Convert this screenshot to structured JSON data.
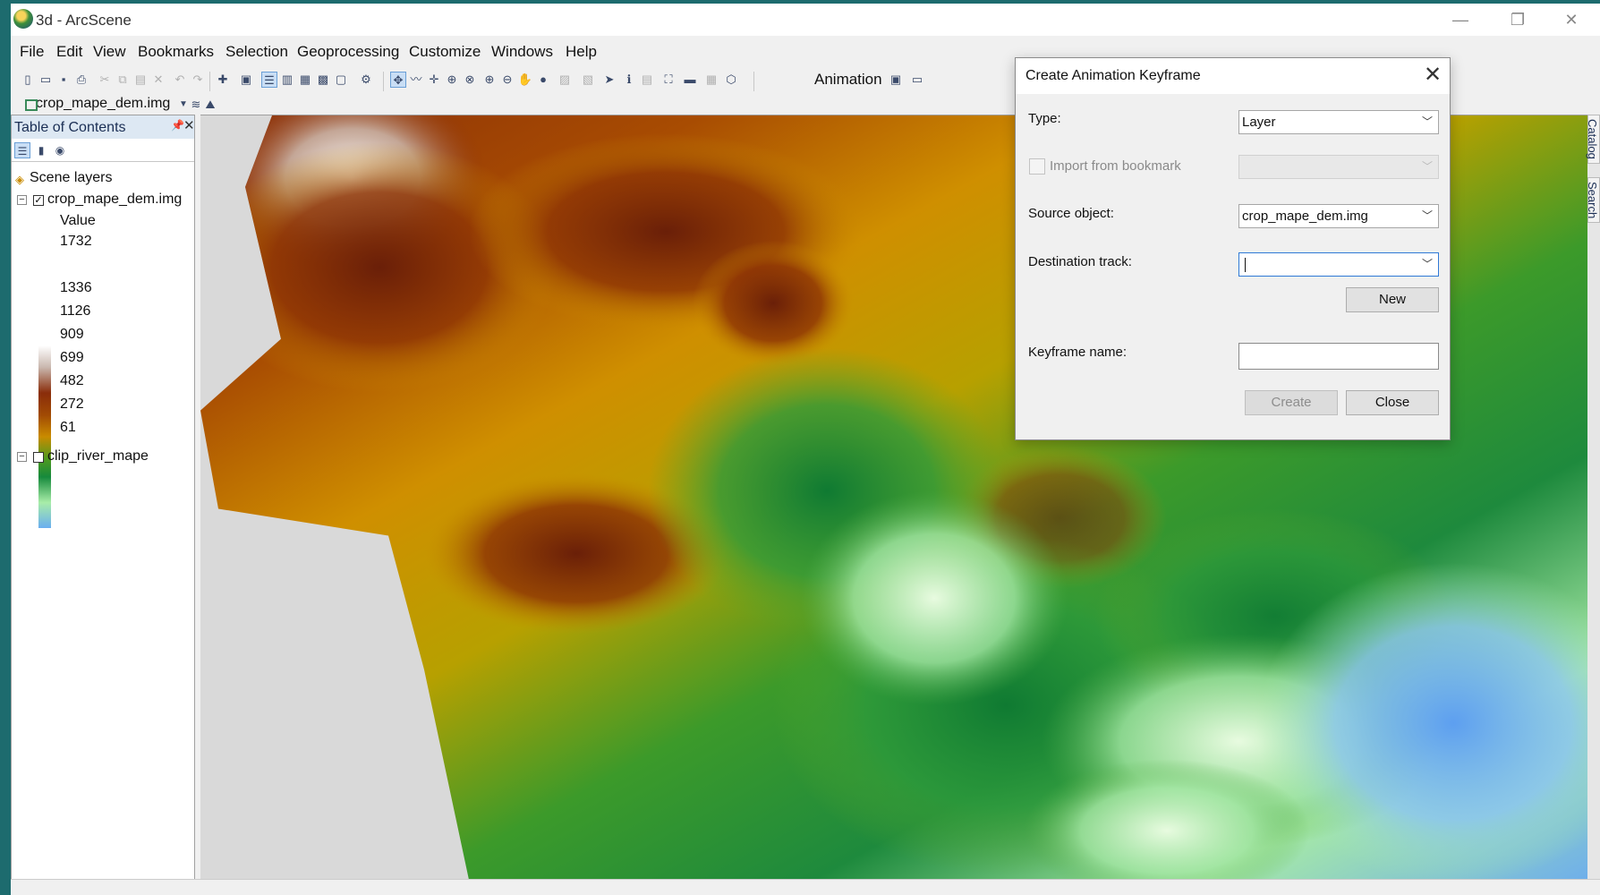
{
  "window": {
    "title": "3d - ArcScene",
    "minimize_glyph": "—",
    "restore_glyph": "❐",
    "close_glyph": "✕"
  },
  "menu": [
    "File",
    "Edit",
    "View",
    "Bookmarks",
    "Selection",
    "Geoprocessing",
    "Customize",
    "Windows",
    "Help"
  ],
  "toolbar": {
    "animation_label": "Animation",
    "layer_combo_value": "crop_mape_dem.img"
  },
  "toc": {
    "title": "Table of Contents",
    "pin_glyph": "📌",
    "close_glyph": "✕",
    "scene_layers_label": "Scene layers",
    "layers": [
      {
        "name": "crop_mape_dem.img",
        "checked": true,
        "legend_heading": "Value",
        "legend_values": [
          "1732",
          "1336",
          "1126",
          "909",
          "699",
          "482",
          "272",
          "61"
        ]
      },
      {
        "name": "clip_river_mape",
        "checked": false
      }
    ]
  },
  "right_dock": {
    "catalog_label": "Catalog",
    "search_label": "Search"
  },
  "dialog": {
    "title": "Create Animation Keyframe",
    "close_glyph": "✕",
    "type_label": "Type:",
    "type_value": "Layer",
    "import_bookmark_label": "Import from bookmark",
    "import_bookmark_checked": false,
    "bookmark_value": "",
    "source_object_label": "Source object:",
    "source_object_value": "crop_mape_dem.img",
    "destination_track_label": "Destination track:",
    "destination_track_value": "",
    "new_button": "New",
    "keyframe_name_label": "Keyframe name:",
    "keyframe_name_value": "",
    "create_button": "Create",
    "close_button": "Close"
  },
  "colors": {
    "frame": "#1d6b6e",
    "elevation_ramp": [
      "#ffffff",
      "#8a2d0a",
      "#c98b00",
      "#168a3c",
      "#a8eda8",
      "#6aaef0"
    ],
    "focus_border": "#2f79d6"
  }
}
